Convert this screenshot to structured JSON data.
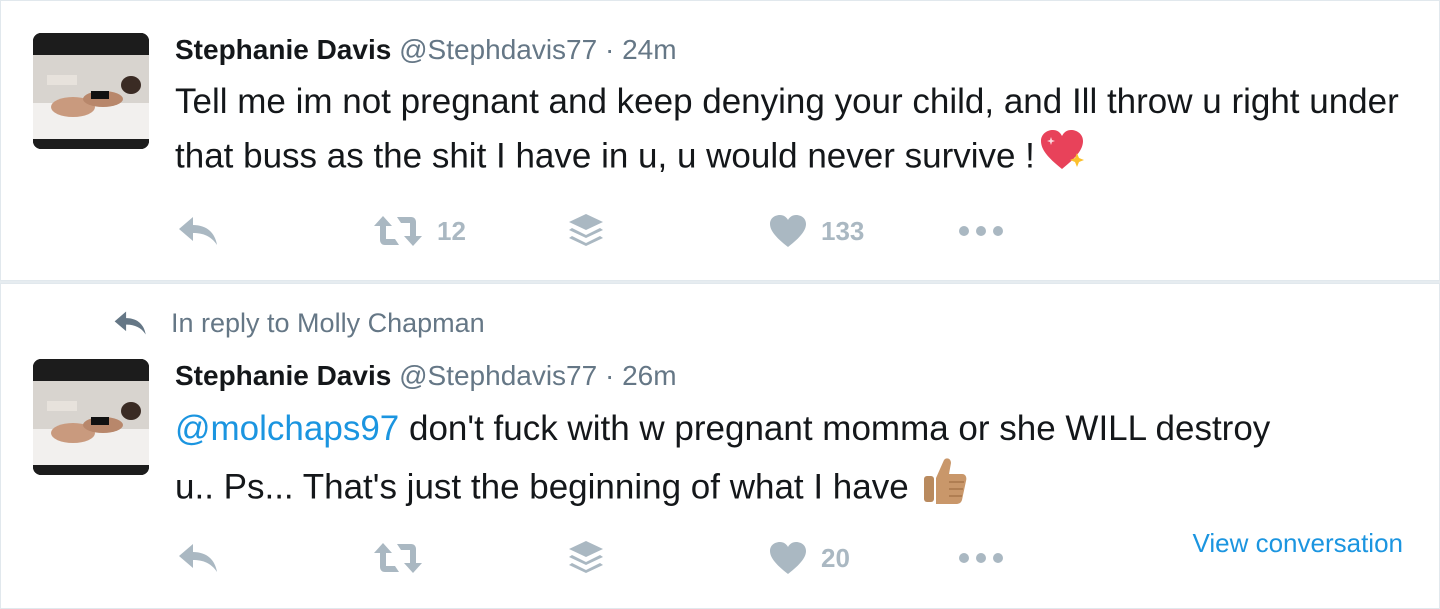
{
  "tweets": [
    {
      "author_name": "Stephanie Davis",
      "handle": "@Stephdavis77",
      "separator": "·",
      "time": "24m",
      "text": "Tell me im not pregnant and keep denying your child, and Ill throw u right under that buss as the shit I have in u, u would never survive !",
      "emoji": "sparkling-heart",
      "retweet_count": "12",
      "like_count": "133"
    },
    {
      "reply_context": "In reply to Molly Chapman",
      "author_name": "Stephanie Davis",
      "handle": "@Stephdavis77",
      "separator": "·",
      "time": "26m",
      "mention": "@molchaps97",
      "text": " don't fuck with w pregnant momma or she WILL destroy u.. Ps... That's just the beginning of what I have ",
      "emoji": "thumbs-up-medium-skin",
      "retweet_count": "",
      "like_count": "20",
      "view_conversation": "View conversation"
    }
  ],
  "colors": {
    "link": "#1b95e0",
    "muted": "#657786",
    "icon": "#aab8c2",
    "text": "#14171a"
  }
}
